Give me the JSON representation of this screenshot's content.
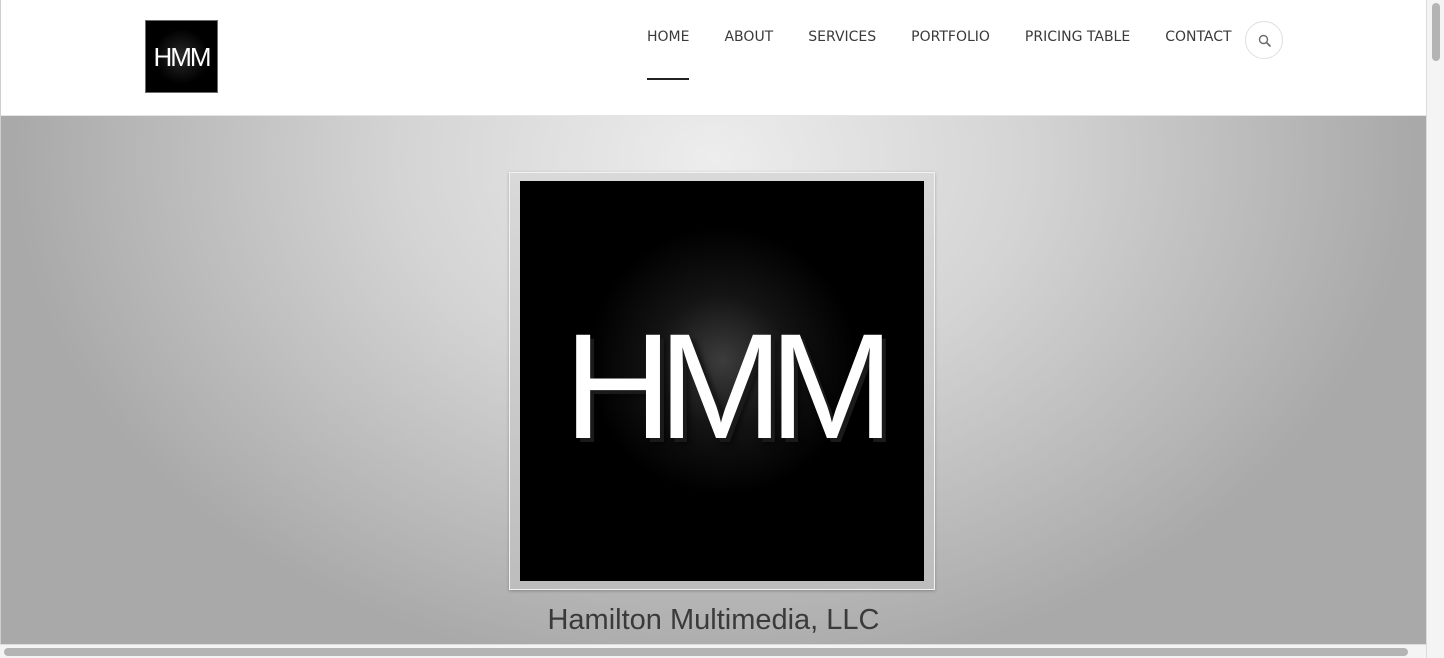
{
  "header": {
    "logo_text": "HMM",
    "nav": [
      {
        "label": "HOME",
        "active": true
      },
      {
        "label": "ABOUT"
      },
      {
        "label": "SERVICES"
      },
      {
        "label": "PORTFOLIO"
      },
      {
        "label": "PRICING TABLE"
      },
      {
        "label": "CONTACT"
      }
    ],
    "search_icon": "search-icon"
  },
  "hero": {
    "logo_text": "HMM",
    "caption": "Hamilton Multimedia, LLC"
  },
  "colors": {
    "text": "#3a3a3a",
    "active_underline": "#222222",
    "logo_bg": "#000000"
  }
}
